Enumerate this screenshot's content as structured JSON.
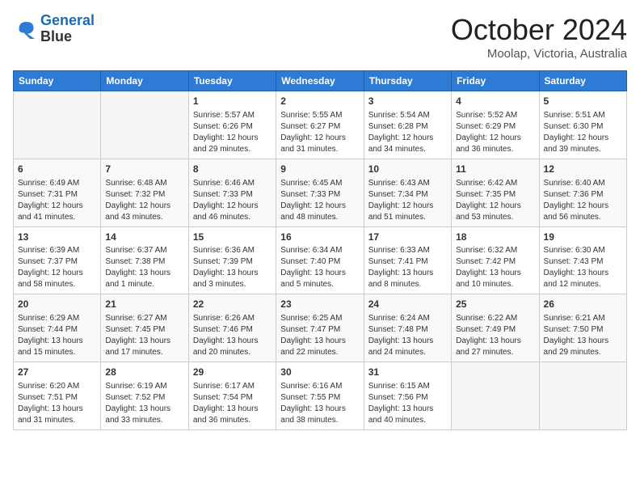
{
  "header": {
    "logo_line1": "General",
    "logo_line2": "Blue",
    "month_title": "October 2024",
    "location": "Moolap, Victoria, Australia"
  },
  "days_of_week": [
    "Sunday",
    "Monday",
    "Tuesday",
    "Wednesday",
    "Thursday",
    "Friday",
    "Saturday"
  ],
  "weeks": [
    [
      {
        "day": "",
        "empty": true
      },
      {
        "day": "",
        "empty": true
      },
      {
        "day": "1",
        "sunrise": "Sunrise: 5:57 AM",
        "sunset": "Sunset: 6:26 PM",
        "daylight": "Daylight: 12 hours and 29 minutes."
      },
      {
        "day": "2",
        "sunrise": "Sunrise: 5:55 AM",
        "sunset": "Sunset: 6:27 PM",
        "daylight": "Daylight: 12 hours and 31 minutes."
      },
      {
        "day": "3",
        "sunrise": "Sunrise: 5:54 AM",
        "sunset": "Sunset: 6:28 PM",
        "daylight": "Daylight: 12 hours and 34 minutes."
      },
      {
        "day": "4",
        "sunrise": "Sunrise: 5:52 AM",
        "sunset": "Sunset: 6:29 PM",
        "daylight": "Daylight: 12 hours and 36 minutes."
      },
      {
        "day": "5",
        "sunrise": "Sunrise: 5:51 AM",
        "sunset": "Sunset: 6:30 PM",
        "daylight": "Daylight: 12 hours and 39 minutes."
      }
    ],
    [
      {
        "day": "6",
        "sunrise": "Sunrise: 6:49 AM",
        "sunset": "Sunset: 7:31 PM",
        "daylight": "Daylight: 12 hours and 41 minutes."
      },
      {
        "day": "7",
        "sunrise": "Sunrise: 6:48 AM",
        "sunset": "Sunset: 7:32 PM",
        "daylight": "Daylight: 12 hours and 43 minutes."
      },
      {
        "day": "8",
        "sunrise": "Sunrise: 6:46 AM",
        "sunset": "Sunset: 7:33 PM",
        "daylight": "Daylight: 12 hours and 46 minutes."
      },
      {
        "day": "9",
        "sunrise": "Sunrise: 6:45 AM",
        "sunset": "Sunset: 7:33 PM",
        "daylight": "Daylight: 12 hours and 48 minutes."
      },
      {
        "day": "10",
        "sunrise": "Sunrise: 6:43 AM",
        "sunset": "Sunset: 7:34 PM",
        "daylight": "Daylight: 12 hours and 51 minutes."
      },
      {
        "day": "11",
        "sunrise": "Sunrise: 6:42 AM",
        "sunset": "Sunset: 7:35 PM",
        "daylight": "Daylight: 12 hours and 53 minutes."
      },
      {
        "day": "12",
        "sunrise": "Sunrise: 6:40 AM",
        "sunset": "Sunset: 7:36 PM",
        "daylight": "Daylight: 12 hours and 56 minutes."
      }
    ],
    [
      {
        "day": "13",
        "sunrise": "Sunrise: 6:39 AM",
        "sunset": "Sunset: 7:37 PM",
        "daylight": "Daylight: 12 hours and 58 minutes."
      },
      {
        "day": "14",
        "sunrise": "Sunrise: 6:37 AM",
        "sunset": "Sunset: 7:38 PM",
        "daylight": "Daylight: 13 hours and 1 minute."
      },
      {
        "day": "15",
        "sunrise": "Sunrise: 6:36 AM",
        "sunset": "Sunset: 7:39 PM",
        "daylight": "Daylight: 13 hours and 3 minutes."
      },
      {
        "day": "16",
        "sunrise": "Sunrise: 6:34 AM",
        "sunset": "Sunset: 7:40 PM",
        "daylight": "Daylight: 13 hours and 5 minutes."
      },
      {
        "day": "17",
        "sunrise": "Sunrise: 6:33 AM",
        "sunset": "Sunset: 7:41 PM",
        "daylight": "Daylight: 13 hours and 8 minutes."
      },
      {
        "day": "18",
        "sunrise": "Sunrise: 6:32 AM",
        "sunset": "Sunset: 7:42 PM",
        "daylight": "Daylight: 13 hours and 10 minutes."
      },
      {
        "day": "19",
        "sunrise": "Sunrise: 6:30 AM",
        "sunset": "Sunset: 7:43 PM",
        "daylight": "Daylight: 13 hours and 12 minutes."
      }
    ],
    [
      {
        "day": "20",
        "sunrise": "Sunrise: 6:29 AM",
        "sunset": "Sunset: 7:44 PM",
        "daylight": "Daylight: 13 hours and 15 minutes."
      },
      {
        "day": "21",
        "sunrise": "Sunrise: 6:27 AM",
        "sunset": "Sunset: 7:45 PM",
        "daylight": "Daylight: 13 hours and 17 minutes."
      },
      {
        "day": "22",
        "sunrise": "Sunrise: 6:26 AM",
        "sunset": "Sunset: 7:46 PM",
        "daylight": "Daylight: 13 hours and 20 minutes."
      },
      {
        "day": "23",
        "sunrise": "Sunrise: 6:25 AM",
        "sunset": "Sunset: 7:47 PM",
        "daylight": "Daylight: 13 hours and 22 minutes."
      },
      {
        "day": "24",
        "sunrise": "Sunrise: 6:24 AM",
        "sunset": "Sunset: 7:48 PM",
        "daylight": "Daylight: 13 hours and 24 minutes."
      },
      {
        "day": "25",
        "sunrise": "Sunrise: 6:22 AM",
        "sunset": "Sunset: 7:49 PM",
        "daylight": "Daylight: 13 hours and 27 minutes."
      },
      {
        "day": "26",
        "sunrise": "Sunrise: 6:21 AM",
        "sunset": "Sunset: 7:50 PM",
        "daylight": "Daylight: 13 hours and 29 minutes."
      }
    ],
    [
      {
        "day": "27",
        "sunrise": "Sunrise: 6:20 AM",
        "sunset": "Sunset: 7:51 PM",
        "daylight": "Daylight: 13 hours and 31 minutes."
      },
      {
        "day": "28",
        "sunrise": "Sunrise: 6:19 AM",
        "sunset": "Sunset: 7:52 PM",
        "daylight": "Daylight: 13 hours and 33 minutes."
      },
      {
        "day": "29",
        "sunrise": "Sunrise: 6:17 AM",
        "sunset": "Sunset: 7:54 PM",
        "daylight": "Daylight: 13 hours and 36 minutes."
      },
      {
        "day": "30",
        "sunrise": "Sunrise: 6:16 AM",
        "sunset": "Sunset: 7:55 PM",
        "daylight": "Daylight: 13 hours and 38 minutes."
      },
      {
        "day": "31",
        "sunrise": "Sunrise: 6:15 AM",
        "sunset": "Sunset: 7:56 PM",
        "daylight": "Daylight: 13 hours and 40 minutes."
      },
      {
        "day": "",
        "empty": true
      },
      {
        "day": "",
        "empty": true
      }
    ]
  ]
}
